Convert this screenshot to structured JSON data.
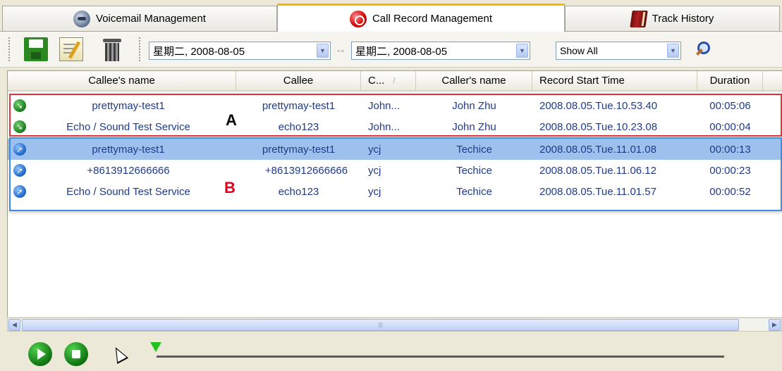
{
  "tabs": [
    {
      "label": "Voicemail Management",
      "icon": "voicemail-icon"
    },
    {
      "label": "Call Record Management",
      "icon": "record-icon",
      "active": true
    },
    {
      "label": "Track History",
      "icon": "book-icon"
    }
  ],
  "toolbar": {
    "save_icon": "save-icon",
    "edit_icon": "edit-icon",
    "delete_icon": "trash-icon",
    "date_from": "星期二, 2008-08-05",
    "date_to": "星期二, 2008-08-05",
    "swap_symbol": "↔",
    "filter": "Show All",
    "search_icon": "search-icon"
  },
  "table": {
    "columns": [
      "Callee's name",
      "Callee",
      "C...",
      "Caller's name",
      "Record Start Time",
      "Duration"
    ],
    "rows": [
      {
        "direction": "incoming",
        "callee_name": "prettymay-test1",
        "callee": "prettymay-test1",
        "caller": "John...",
        "caller_name": "John Zhu",
        "start": "2008.08.05.Tue.10.53.40",
        "duration": "00:05:06"
      },
      {
        "direction": "incoming",
        "callee_name": "Echo / Sound Test Service",
        "callee": "echo123",
        "caller": "John...",
        "caller_name": "John Zhu",
        "start": "2008.08.05.Tue.10.23.08",
        "duration": "00:00:04"
      },
      {
        "direction": "outgoing",
        "callee_name": "prettymay-test1",
        "callee": "prettymay-test1",
        "caller": "ycj",
        "caller_name": "Techice",
        "start": "2008.08.05.Tue.11.01.08",
        "duration": "00:00:13",
        "selected": true
      },
      {
        "direction": "outgoing",
        "callee_name": "+8613912666666",
        "callee": "+8613912666666",
        "caller": "ycj",
        "caller_name": "Techice",
        "start": "2008.08.05.Tue.11.06.12",
        "duration": "00:00:23"
      },
      {
        "direction": "outgoing",
        "callee_name": "Echo / Sound Test Service",
        "callee": "echo123",
        "caller": "ycj",
        "caller_name": "Techice",
        "start": "2008.08.05.Tue.11.01.57",
        "duration": "00:00:52"
      }
    ]
  },
  "annotations": {
    "a": "A",
    "b": "B",
    "a_color": "#e8303a",
    "b_color": "#3c8de8"
  },
  "player": {
    "play_icon": "play-icon",
    "stop_icon": "stop-icon",
    "progress": 0
  },
  "colors": {
    "selected_row": "#9ec0ec",
    "active_tab_accent": "#f5b700",
    "link_text": "#1f3b8a"
  }
}
